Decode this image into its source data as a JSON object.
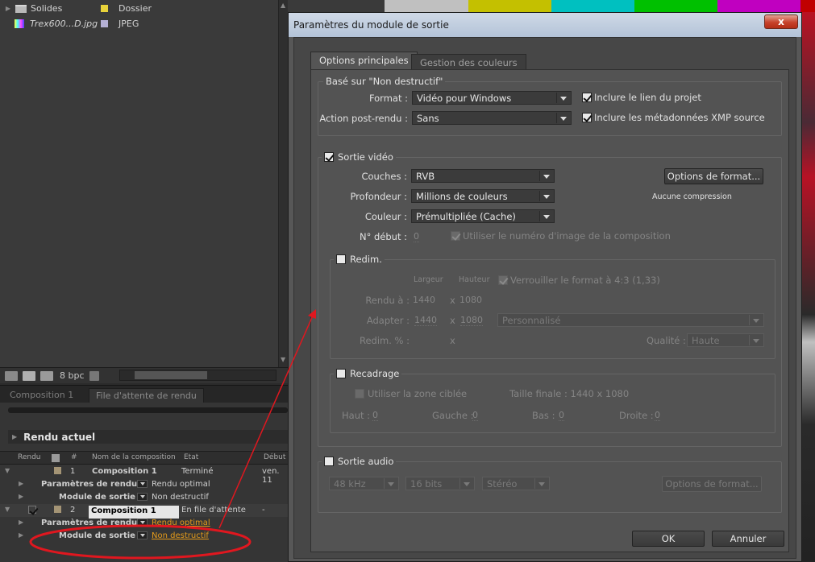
{
  "project_panel": {
    "items": [
      {
        "name": "Solides",
        "type": "Dossier",
        "swatch": "#e8d23a"
      },
      {
        "name": "Trex600...D.jpg",
        "type": "JPEG",
        "swatch": "#b4b0d4"
      }
    ],
    "footer": {
      "bpc": "8 bpc"
    }
  },
  "render_queue": {
    "tabs": [
      "Composition 1",
      "File d'attente de rendu"
    ],
    "current_render": "Rendu actuel",
    "columns": [
      "Rendu",
      "#",
      "Nom de la composition",
      "Etat",
      "Début"
    ],
    "rows": [
      {
        "num": "1",
        "comp": "Composition 1",
        "status": "Terminé",
        "start": "ven. 11"
      },
      {
        "num": "2",
        "comp": "Composition 1",
        "status": "En file d'attente",
        "start": "-"
      }
    ],
    "render_settings_label": "Paramètres de rendu :",
    "output_module_label": "Module de sortie :",
    "render_settings_value": "Rendu optimal",
    "output_module_value": "Non destructif",
    "row2_render_settings_value": "Rendu optimal",
    "row2_output_module_value": "Non destructif"
  },
  "dialog": {
    "title": "Paramètres du module de sortie",
    "close": "x",
    "tabs": [
      "Options principales",
      "Gestion des couleurs"
    ],
    "based_on": "Basé sur \"Non destructif\"",
    "format_label": "Format :",
    "format_value": "Vidéo pour Windows",
    "post_render_label": "Action post-rendu :",
    "post_render_value": "Sans",
    "include_project_link": "Inclure le lien du projet",
    "include_xmp": "Inclure les métadonnées XMP source",
    "video_output": "Sortie vidéo",
    "channels_label": "Couches :",
    "channels_value": "RVB",
    "depth_label": "Profondeur :",
    "depth_value": "Millions de couleurs",
    "color_label": "Couleur :",
    "color_value": "Prémultipliée (Cache)",
    "start_label": "N° début :",
    "start_value": "0",
    "use_comp_frame": "Utiliser le numéro d'image de la composition",
    "format_options": "Options de format...",
    "compression": "Aucune compression",
    "resize": {
      "title": "Redim.",
      "width_header": "Largeur",
      "height_header": "Hauteur",
      "lock_ratio": "Verrouiller le format à 4:3 (1,33)",
      "rendered_at_label": "Rendu à :",
      "rendered_w": "1440",
      "rendered_h": "1080",
      "fit_label": "Adapter :",
      "fit_w": "1440",
      "fit_h": "1080",
      "fit_preset": "Personnalisé",
      "percent_label": "Redim. % :",
      "x": "x",
      "quality_label": "Qualité :",
      "quality_value": "Haute"
    },
    "crop": {
      "title": "Recadrage",
      "use_roi": "Utiliser la zone ciblée",
      "final_size": "Taille finale : 1440 x 1080",
      "top_label": "Haut :",
      "top": "0",
      "left_label": "Gauche :",
      "left": "0",
      "bottom_label": "Bas :",
      "bottom": "0",
      "right_label": "Droite :",
      "right": "0"
    },
    "audio": {
      "title": "Sortie audio",
      "rate": "48 kHz",
      "bits": "16 bits",
      "channels": "Stéréo",
      "format_options": "Options de format..."
    },
    "ok": "OK",
    "cancel": "Annuler"
  },
  "colors": {
    "annotation": "#e0171f",
    "accent_orange": "#e59b1a"
  }
}
